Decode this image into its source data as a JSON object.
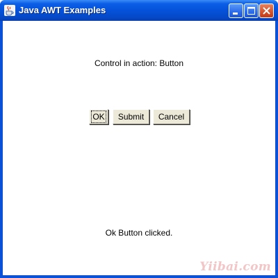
{
  "window": {
    "title": "Java AWT Examples",
    "app_icon": "java-cup-icon",
    "controls": [
      "minimize-icon",
      "maximize-icon",
      "close-icon"
    ]
  },
  "header": {
    "text": "Control in action: Button"
  },
  "buttons": [
    {
      "label": "OK",
      "focused": true
    },
    {
      "label": "Submit",
      "focused": false
    },
    {
      "label": "Cancel",
      "focused": false
    }
  ],
  "status": {
    "text": "Ok Button clicked."
  },
  "watermark": {
    "text": "Yiibai.com"
  },
  "colors": {
    "titlebar": "#0552d9",
    "window_background": "#ffffff",
    "button_face": "#ece9d8",
    "close_button": "#d2522c"
  }
}
